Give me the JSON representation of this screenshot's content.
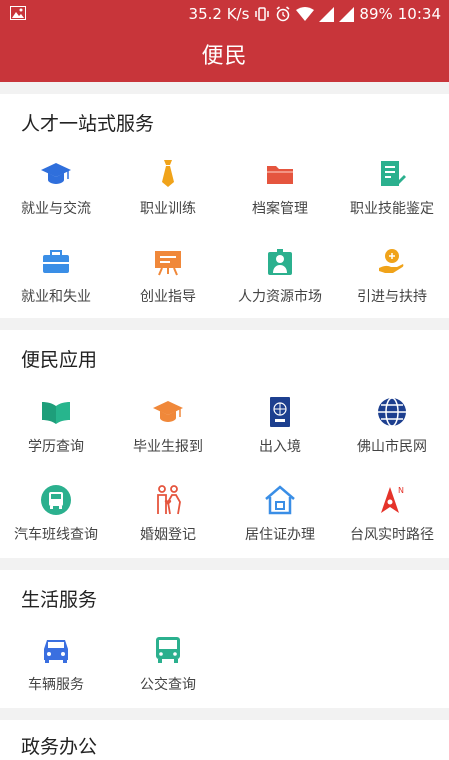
{
  "status_bar": {
    "speed": "35.2 K/s",
    "battery": "89%",
    "time": "10:34"
  },
  "app_bar": {
    "title": "便民"
  },
  "sections": [
    {
      "title": "人才一站式服务",
      "items": [
        {
          "label": "就业与交流",
          "icon": "graduation-cap-icon",
          "color": "#2f6fdc"
        },
        {
          "label": "职业训练",
          "icon": "necktie-icon",
          "color": "#f0a31a"
        },
        {
          "label": "档案管理",
          "icon": "folder-icon",
          "color": "#e5553e"
        },
        {
          "label": "职业技能鉴定",
          "icon": "document-edit-icon",
          "color": "#2bb08e"
        },
        {
          "label": "就业和失业",
          "icon": "briefcase-icon",
          "color": "#3a8ee6"
        },
        {
          "label": "创业指导",
          "icon": "presentation-board-icon",
          "color": "#f0883a"
        },
        {
          "label": "人力资源市场",
          "icon": "person-id-icon",
          "color": "#2bb08e"
        },
        {
          "label": "引进与扶持",
          "icon": "hand-support-icon",
          "color": "#f0a31a"
        }
      ]
    },
    {
      "title": "便民应用",
      "items": [
        {
          "label": "学历查询",
          "icon": "open-book-icon",
          "color": "#1e9e7a"
        },
        {
          "label": "毕业生报到",
          "icon": "graduation-cap-icon",
          "color": "#f0883a"
        },
        {
          "label": "出入境",
          "icon": "passport-icon",
          "color": "#1d3f8f"
        },
        {
          "label": "佛山市民网",
          "icon": "globe-icon",
          "color": "#1d3f8f"
        },
        {
          "label": "汽车班线查询",
          "icon": "bus-circle-icon",
          "color": "#2bb08e"
        },
        {
          "label": "婚姻登记",
          "icon": "couple-icon",
          "color": "#e5553e"
        },
        {
          "label": "居住证办理",
          "icon": "house-icon",
          "color": "#3a8ee6"
        },
        {
          "label": "台风实时路径",
          "icon": "compass-north-icon",
          "color": "#e5332a"
        }
      ]
    },
    {
      "title": "生活服务",
      "items": [
        {
          "label": "车辆服务",
          "icon": "car-icon",
          "color": "#3a6fe0"
        },
        {
          "label": "公交查询",
          "icon": "bus-front-icon",
          "color": "#2bb08e"
        }
      ]
    },
    {
      "title": "政务办公",
      "items": []
    }
  ]
}
